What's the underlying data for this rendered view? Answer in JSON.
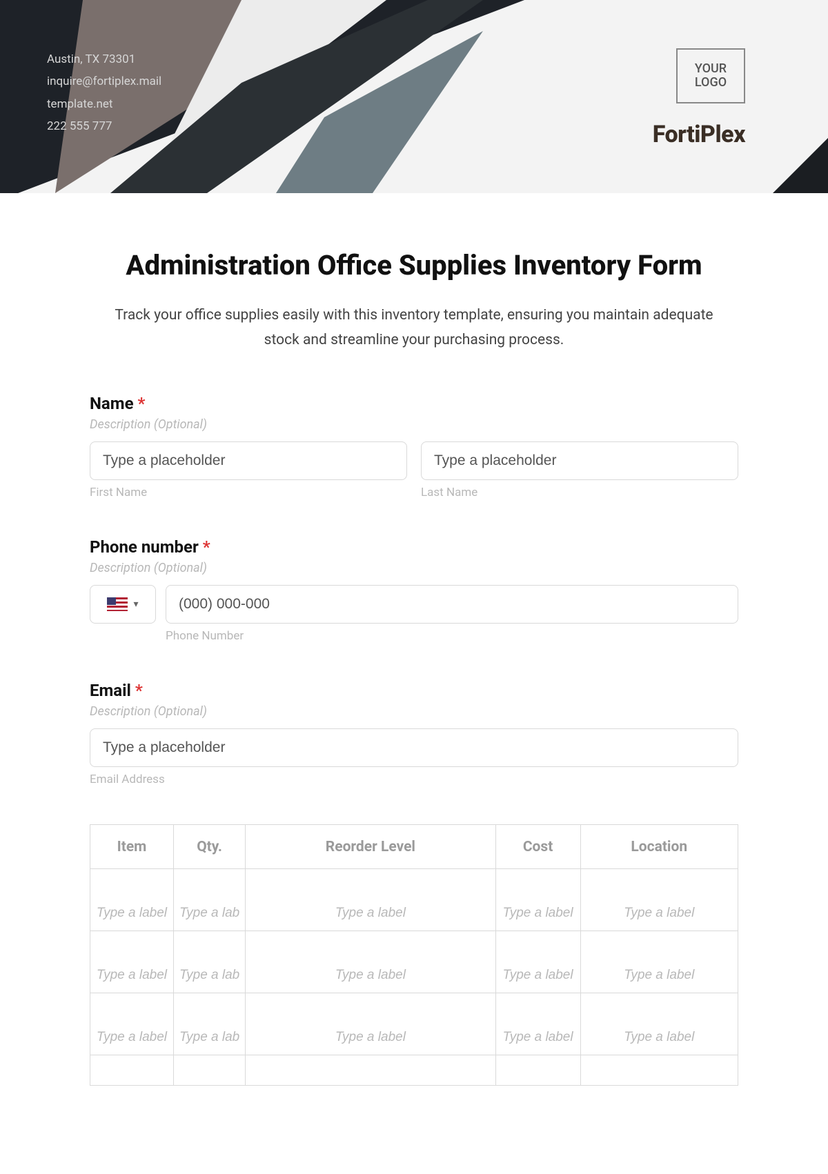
{
  "header": {
    "address": "Austin, TX 73301",
    "email": "inquire@fortiplex.mail",
    "website": "template.net",
    "phone": "222 555 777",
    "logo_text": "YOUR LOGO",
    "brand": "FortiPlex"
  },
  "form": {
    "title": "Administration Office Supplies Inventory Form",
    "subtitle": "Track your office supplies easily with this inventory template, ensuring you maintain adequate stock and streamline your purchasing process."
  },
  "name_field": {
    "label": "Name",
    "required_mark": "*",
    "desc": "Description (Optional)",
    "first_placeholder": "Type a placeholder",
    "first_sub": "First Name",
    "last_placeholder": "Type a placeholder",
    "last_sub": "Last Name"
  },
  "phone_field": {
    "label": "Phone number",
    "required_mark": "*",
    "desc": "Description (Optional)",
    "placeholder": "(000) 000-000",
    "sub": "Phone Number"
  },
  "email_field": {
    "label": "Email",
    "required_mark": "*",
    "desc": "Description (Optional)",
    "placeholder": "Type a placeholder",
    "sub": "Email Address"
  },
  "table": {
    "headers": [
      "Item",
      "Qty.",
      "Reorder Level",
      "Cost",
      "Location"
    ],
    "cell_placeholder": "Type a label",
    "rows": 3
  }
}
